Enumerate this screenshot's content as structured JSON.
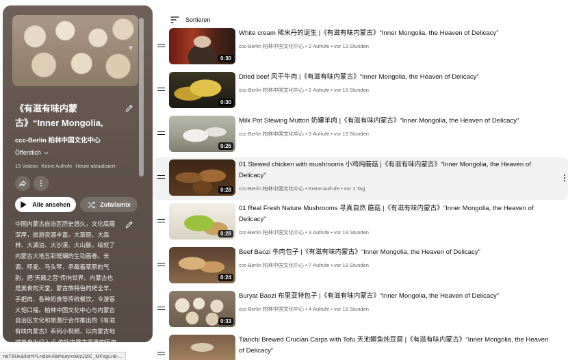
{
  "playlist": {
    "title": "《有滋有味内蒙古》“Inner Mongolia, the Heaven of...",
    "channel": "ccc-Berlin 柏林中国文化中心",
    "visibility": "Öffentlich",
    "stats": [
      "13 Videos",
      "Keine Aufrufe",
      "Heute aktualisiert"
    ],
    "play_all_label": "Alle ansehen",
    "shuffle_label": "Zufallsmix",
    "description": "中国内蒙古自治区历史悠久，文化底蕴深厚，旅游资源丰富。大草原、大森林、大湖泊、大沙漠、大山脉，绘就了内蒙古大地五彩斑斓的生动画卷。长调、呼麦、马头琴，承载着草原的气韵，把“天籁之音”传向世界。内蒙古也是美食的天堂，蒙古族特色的烤全羊、手把肉、各种奶食等传统餐饮，令游客大饱口福。柏林中国文化中心与内蒙古自治区文化和旅游厅合作推出的《有滋有味内蒙古》系列小视频，以内蒙古地域美食为切入点,依托内蒙古厚重的历史文化底蕴,充分展示中国内蒙古丰富的自"
  },
  "status_url": "neT8Uk&list=PLndsK4BrNuiyvsWzJ2iC_MFxgLn8-...",
  "sort_label": "Sortieren",
  "videos": [
    {
      "title": "White cream 稀米丹的诞生 |《有滋有味内蒙古》“Inner Mongolia, the Heaven of Delicacy”",
      "channel": "ccc-Berlin 柏林中国文化中心",
      "views": "2 Aufrufe",
      "age": "vor 13 Stunden",
      "duration": "0:30"
    },
    {
      "title": "Dried beef 风干牛肉 |《有滋有味内蒙古》“Inner Mongolia, the Heaven of Delicacy”",
      "channel": "ccc-Berlin 柏林中国文化中心",
      "views": "2 Aufrufe",
      "age": "vor 19 Stunden",
      "duration": "0:30"
    },
    {
      "title": "Milk Pot Stewing Mutton 奶罐羊肉 |《有滋有味内蒙古》“Inner Mongolia, the Heaven of Delicacy”",
      "channel": "ccc-Berlin 柏林中国文化中心",
      "views": "3 Aufrufe",
      "age": "vor 19 Stunden",
      "duration": "0:26"
    },
    {
      "title": "01 Stewed chicken with mushrooms 小鸡炖蘑菇 |《有滋有味内蒙古》“Inner Mongolia, the Heaven of Delicacy”",
      "channel": "ccc-Berlin 柏林中国文化中心",
      "views": "Keine Aufrufe",
      "age": "vor 1 Tag",
      "duration": "0:28"
    },
    {
      "title": "01 Real Fresh Nature Mushrooms 寻真自然 蘑菇 |《有滋有味内蒙古》“Inner Mongolia, the Heaven of Delicacy”",
      "channel": "ccc-Berlin 柏林中国文化中心",
      "views": "3 Aufrufe",
      "age": "vor 19 Stunden",
      "duration": "0:28"
    },
    {
      "title": "Beef Baozi 牛肉包子 |《有滋有味内蒙古》“Inner Mongolia, the Heaven of Delicacy”",
      "channel": "ccc-Berlin 柏林中国文化中心",
      "views": "7 Aufrufe",
      "age": "vor 19 Stunden",
      "duration": "0:24"
    },
    {
      "title": "Buryat Baozi 布里亚特包子 |《有滋有味内蒙古》“Inner Mongolia, the Heaven of Delicacy”",
      "channel": "ccc-Berlin 柏林中国文化中心",
      "views": "4 Aufrufe",
      "age": "vor 19 Stunden",
      "duration": "0:33"
    },
    {
      "title": "Tianchi Brewed Crucian Carps with Tofu 天池鲫鱼炖豆腐 |《有滋有味内蒙古》“Inner Mongolia, the Heaven of Delicacy”",
      "channel": "",
      "views": "",
      "age": "",
      "duration": ""
    }
  ]
}
